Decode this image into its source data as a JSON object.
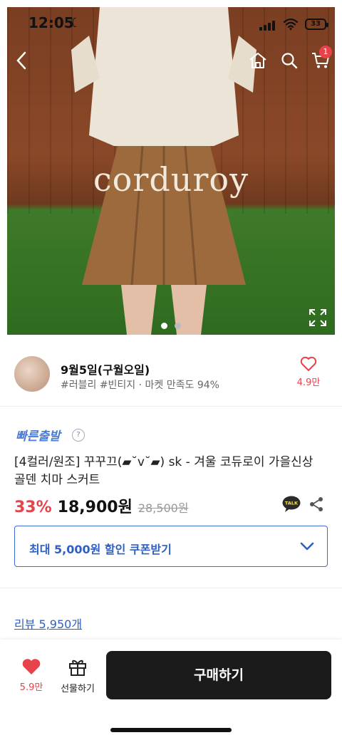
{
  "status": {
    "time": "12:05",
    "battery": "33"
  },
  "nav": {
    "cart_count": "1"
  },
  "hero": {
    "overlay_text": "corduroy",
    "slides": 2,
    "active_slide": 0
  },
  "seller": {
    "name": "9월5일(구월오일)",
    "tags": "#러블리 #빈티지 · 마켓 만족도 94%",
    "like_count": "4.9만"
  },
  "product": {
    "fast_shipping": "빠른출발",
    "help": "?",
    "title": "[4컬러/원조] 꾸꾸끄(▰˘v˘▰) sk - 겨울 코듀로이 가을신상 골덴 치마 스커트",
    "discount": "33%",
    "price": "18,900원",
    "original_price": "28,500원",
    "talk_label": "TALK",
    "coupon_label": "최대 5,000원 할인 쿠폰받기",
    "reviews": "리뷰 5,950개"
  },
  "bottom": {
    "like_count": "5.9만",
    "gift_label": "선물하기",
    "buy_label": "구매하기"
  },
  "colors": {
    "accent": "#e8424a",
    "link": "#2e5fc4",
    "buy_bg": "#1b1b1b"
  },
  "icons": [
    "back-icon",
    "home-icon",
    "search-icon",
    "cart-icon",
    "expand-icon",
    "heart-outline-icon",
    "kakao-talk-icon",
    "share-icon",
    "chevron-down-icon",
    "heart-filled-icon",
    "gift-icon"
  ]
}
